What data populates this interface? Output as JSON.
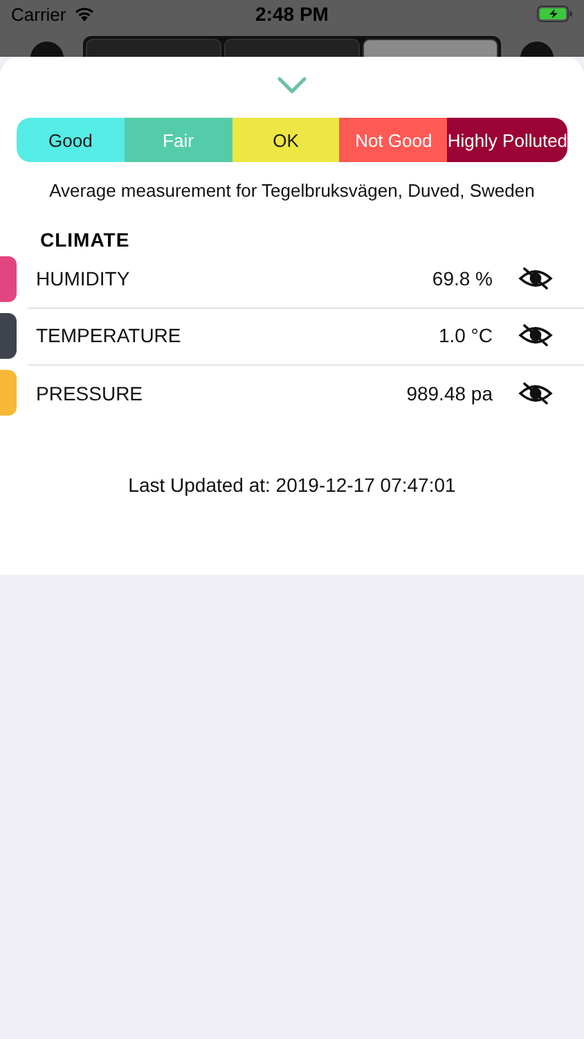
{
  "status_bar": {
    "carrier": "Carrier",
    "time": "2:48 PM"
  },
  "tabs": [
    {
      "selected": false
    },
    {
      "selected": false
    },
    {
      "selected": true
    }
  ],
  "legend": [
    {
      "label": "Good",
      "color": "#55ede5"
    },
    {
      "label": "Fair",
      "color": "#55cca9"
    },
    {
      "label": "OK",
      "color": "#eee643"
    },
    {
      "label": "Not Good",
      "color": "#fd5a55"
    },
    {
      "label": "Highly Polluted",
      "color": "#9b0235"
    }
  ],
  "caption": "Average measurement for Tegelbruksvägen, Duved, Sweden",
  "section_title": "CLIMATE",
  "measurements": [
    {
      "name": "HUMIDITY",
      "value": "69.8 %",
      "color": "#e2457f"
    },
    {
      "name": "TEMPERATURE",
      "value": "1.0 °C",
      "color": "#3e434d"
    },
    {
      "name": "PRESSURE",
      "value": "989.48 pa",
      "color": "#f8b835"
    }
  ],
  "last_updated": "Last Updated at: 2019-12-17 07:47:01"
}
